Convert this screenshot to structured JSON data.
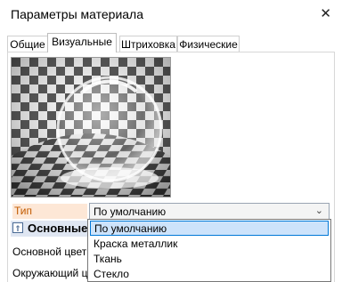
{
  "window": {
    "title": "Параметры материала",
    "close_glyph": "✕"
  },
  "tabs": [
    {
      "label": "Общие"
    },
    {
      "label": "Визуальные",
      "active": true
    },
    {
      "label": "Штриховка"
    },
    {
      "label": "Физические"
    }
  ],
  "material_type": {
    "label": "Тип материала:",
    "value": "По умолчанию",
    "arrow": "⌄",
    "options": [
      "По умолчанию",
      "Краска металлик",
      "Ткань",
      "Стекло"
    ],
    "selected_index": 0
  },
  "section": {
    "title": "Основные",
    "icon": "collapse-icon",
    "icon_glyph": "⇑"
  },
  "fields": {
    "base_color_label": "Основной цвет:",
    "ambient_color_label": "Окружающий цв"
  },
  "colors": {
    "accent": "#0078d7",
    "label_highlight": "#fde7d6",
    "section_bg": "#dfe6f2"
  }
}
